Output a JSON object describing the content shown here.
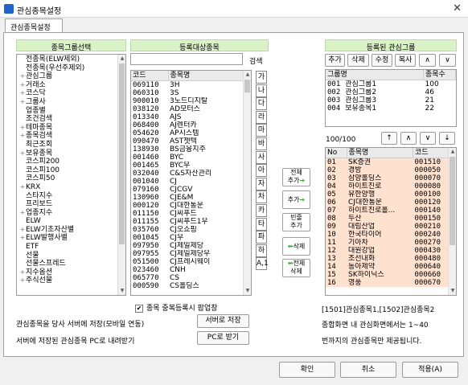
{
  "window": {
    "title": "관심종목설정",
    "close": "✕"
  },
  "tab": "관심종목설정",
  "left": {
    "header": "종목그룹선택",
    "items": [
      {
        "label": "전종목(ELW제외)",
        "expand": ""
      },
      {
        "label": "전종목(우선주제외)",
        "expand": ""
      },
      {
        "label": "관심그룹",
        "expand": "+"
      },
      {
        "label": "거래소",
        "expand": "+"
      },
      {
        "label": "코스닥",
        "expand": "+"
      },
      {
        "label": "그룹사",
        "expand": "+"
      },
      {
        "label": "업종별",
        "expand": ""
      },
      {
        "label": "조건검색",
        "expand": ""
      },
      {
        "label": "테마종목",
        "expand": "+"
      },
      {
        "label": "종목검색",
        "expand": "+"
      },
      {
        "label": "최근조회",
        "expand": ""
      },
      {
        "label": "보유종목",
        "expand": "+"
      },
      {
        "label": "코스피200",
        "expand": ""
      },
      {
        "label": "코스피100",
        "expand": ""
      },
      {
        "label": "코스피50",
        "expand": ""
      },
      {
        "label": "KRX",
        "expand": "+"
      },
      {
        "label": "스타지수",
        "expand": ""
      },
      {
        "label": "프리보드",
        "expand": ""
      },
      {
        "label": "업종지수",
        "expand": "+"
      },
      {
        "label": "ELW",
        "expand": ""
      },
      {
        "label": "ELW기초자산별",
        "expand": "+"
      },
      {
        "label": "ELW발행사별",
        "expand": "+"
      },
      {
        "label": "ETF",
        "expand": ""
      },
      {
        "label": "선물",
        "expand": ""
      },
      {
        "label": "선물스프레드",
        "expand": ""
      },
      {
        "label": "지수옵션",
        "expand": "+"
      },
      {
        "label": "주식선물",
        "expand": "+"
      }
    ]
  },
  "middle": {
    "header": "등록대상종목",
    "search_label": "검색",
    "search_value": "",
    "col_code": "코드",
    "col_name": "종목명",
    "rows": [
      [
        "069110",
        "3H"
      ],
      [
        "060310",
        "3S"
      ],
      [
        "900010",
        "3노드디지탈"
      ],
      [
        "038120",
        "AD모터스"
      ],
      [
        "013340",
        "AJS"
      ],
      [
        "068400",
        "AJ렌터카"
      ],
      [
        "054620",
        "AP시스템"
      ],
      [
        "090470",
        "AST젯텍"
      ],
      [
        "138930",
        "BS금융지주"
      ],
      [
        "001460",
        "BYC"
      ],
      [
        "001465",
        "BYC우"
      ],
      [
        "032040",
        "C&S자산관리"
      ],
      [
        "001040",
        "CJ"
      ],
      [
        "079160",
        "CJCGV"
      ],
      [
        "130960",
        "CJE&M"
      ],
      [
        "000120",
        "CJ대한통운"
      ],
      [
        "011150",
        "CJ씨푸드"
      ],
      [
        "011155",
        "CJ씨푸드1우"
      ],
      [
        "035760",
        "CJ오쇼핑"
      ],
      [
        "001045",
        "CJ우"
      ],
      [
        "097950",
        "CJ제일제당"
      ],
      [
        "097955",
        "CJ제일제당우"
      ],
      [
        "051500",
        "CJ프레시웨이"
      ],
      [
        "023460",
        "CNH"
      ],
      [
        "065770",
        "CS"
      ],
      [
        "000590",
        "CS홀딩스"
      ]
    ],
    "consonants": [
      "가",
      "나",
      "다",
      "라",
      "마",
      "바",
      "사",
      "아",
      "자",
      "차",
      "카",
      "타",
      "파",
      "하",
      "A,1"
    ]
  },
  "movers": {
    "all_add": [
      "전체",
      "추가"
    ],
    "add": "추가",
    "blank_add": [
      "빈줄",
      "추가"
    ],
    "delete": "삭제",
    "all_delete": [
      "전체",
      "삭제"
    ],
    "arrow_right": "➔",
    "arrow_left": "⬅"
  },
  "right": {
    "header": "등록된 관심그룹",
    "buttons": [
      "추가",
      "삭제",
      "수정",
      "복사"
    ],
    "updown": [
      "∧",
      "∨"
    ],
    "group_cols": [
      "그룹명",
      "종목수"
    ],
    "groups": [
      [
        "001",
        "관심그룹1",
        "100"
      ],
      [
        "002",
        "관심그룹2",
        "46"
      ],
      [
        "003",
        "관심그룹3",
        "21"
      ],
      [
        "004",
        "보유종목1",
        "22"
      ]
    ],
    "count": "100/100",
    "order_buttons": [
      "↑",
      "∧",
      "∨",
      "↓"
    ],
    "stock_cols": [
      "No",
      "종목명",
      "코드"
    ],
    "stocks": [
      [
        "01",
        "SK증권",
        "001510"
      ],
      [
        "02",
        "경방",
        "000050"
      ],
      [
        "03",
        "삼양홀딩스",
        "000070"
      ],
      [
        "04",
        "하이트진로",
        "000080"
      ],
      [
        "05",
        "유한양행",
        "000100"
      ],
      [
        "06",
        "CJ대한통운",
        "000120"
      ],
      [
        "07",
        "하이트진로홀...",
        "000140"
      ],
      [
        "08",
        "두산",
        "000150"
      ],
      [
        "09",
        "대림산업",
        "000210"
      ],
      [
        "10",
        "한국타이어",
        "000240"
      ],
      [
        "11",
        "기아차",
        "000270"
      ],
      [
        "12",
        "대원강업",
        "000430"
      ],
      [
        "13",
        "조선내화",
        "000480"
      ],
      [
        "14",
        "동아제약",
        "000640"
      ],
      [
        "15",
        "SK하이닉스",
        "000660"
      ],
      [
        "16",
        "영풍",
        "000670"
      ]
    ]
  },
  "checkbox": {
    "checked": "✔",
    "label": "종목 중복등록시 팝업창"
  },
  "server": {
    "upload_text": "관심종목을 당사 서버에 저장(모바일 연동)",
    "upload_button": "서버로 저장",
    "download_text": "서버에 저장된 관심종목 PC로 내려받기",
    "download_button": "PC로 받기"
  },
  "info": {
    "line1": "[1501]관심종목1,[1502]관심종목2",
    "line2": "종합화면 내 관심화면에서는 1~40",
    "line3": "번까지의 관심종목만 제공됩니다."
  },
  "footer": {
    "ok": "확인",
    "cancel": "취소",
    "apply": "적용(A)"
  },
  "colors": {
    "header_green": "#d9f2c6",
    "selected_row": "#ffe1cf",
    "arrow_green": "#3aa63a"
  }
}
